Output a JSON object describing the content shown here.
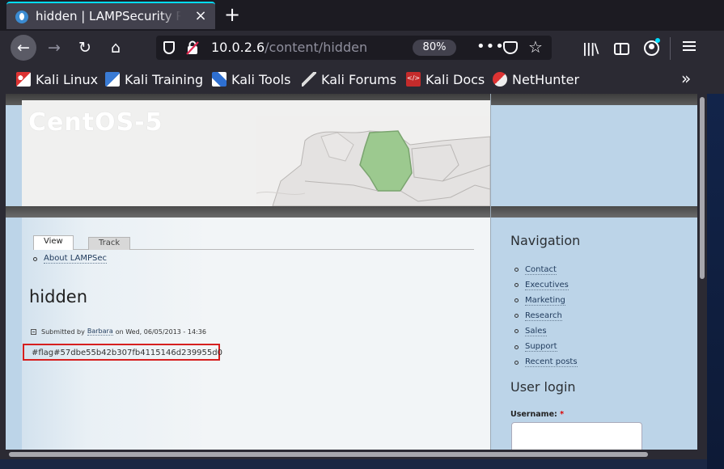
{
  "browser": {
    "tab_title": "hidden | LAMPSecurity R",
    "close_glyph": "×",
    "new_tab_glyph": "+",
    "url_host": "10.0.2.6",
    "url_path": "/content/hidden",
    "zoom": "80%",
    "page_actions_glyph": "•••",
    "star_glyph": "☆",
    "library_glyph": "|||\\",
    "back_glyph": "←",
    "forward_glyph": "→",
    "reload_glyph": "↻",
    "home_glyph": "⌂",
    "bookmarks_more_glyph": "»",
    "accent_color": "#00ddff"
  },
  "bookmarks": [
    {
      "label": "Kali Linux",
      "icon": "kali-dragon-icon"
    },
    {
      "label": "Kali Training",
      "icon": "kali-training-icon"
    },
    {
      "label": "Kali Tools",
      "icon": "kali-tools-icon"
    },
    {
      "label": "Kali Forums",
      "icon": "kali-forums-icon"
    },
    {
      "label": "Kali Docs",
      "icon": "kali-docs-icon"
    },
    {
      "label": "NetHunter",
      "icon": "nethunter-icon"
    }
  ],
  "page": {
    "logo": "CentOS-5",
    "tabs": {
      "view": "View",
      "track": "Track"
    },
    "secondary_link": "About LAMPSec",
    "title": "hidden",
    "submitted_prefix": "Submitted by",
    "author": "Barbara",
    "submitted_suffix": "on Wed, 06/05/2013 - 14:36",
    "flag": "#flag#57dbe55b42b307fb4115146d239955d0"
  },
  "sidebar": {
    "navigation_heading": "Navigation",
    "nav_items": [
      "Contact",
      "Executives",
      "Marketing",
      "Research",
      "Sales",
      "Support",
      "Recent posts"
    ],
    "login_heading": "User login",
    "username_label": "Username:",
    "required_mark": "*"
  }
}
